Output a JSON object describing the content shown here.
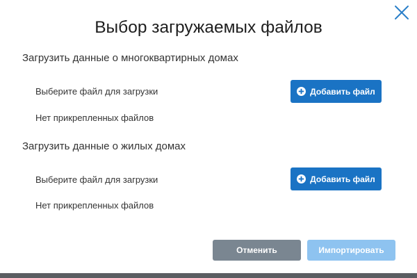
{
  "dialog": {
    "title": "Выбор загружаемых файлов"
  },
  "sections": [
    {
      "title": "Загрузить данные о многоквартирных домах",
      "choose_label": "Выберите файл для загрузки",
      "add_button_label": "Добавить файл",
      "files_status": "Нет прикрепленных файлов"
    },
    {
      "title": "Загрузить данные о жилых домах",
      "choose_label": "Выберите файл для загрузки",
      "add_button_label": "Добавить файл",
      "files_status": "Нет прикрепленных файлов"
    }
  ],
  "footer": {
    "cancel_label": "Отменить",
    "import_label": "Импортировать"
  },
  "icons": {
    "close": "close-icon",
    "add": "plus-circle-icon"
  },
  "colors": {
    "primary": "#1a73c4",
    "cancel": "#7a8691",
    "import_disabled": "#8ec3f0",
    "close_icon": "#2a7fc9"
  }
}
